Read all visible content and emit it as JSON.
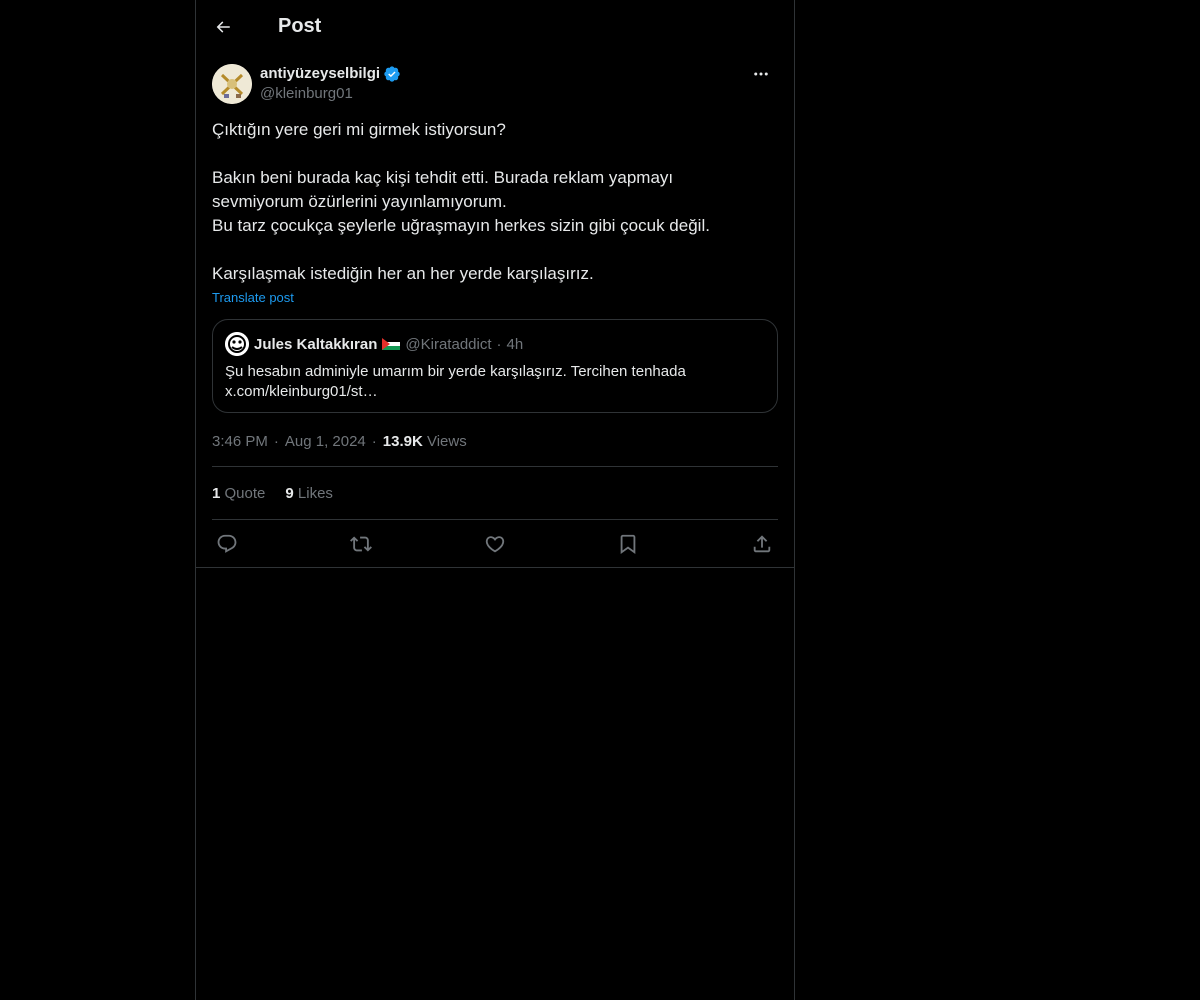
{
  "header": {
    "title": "Post",
    "back_icon": "arrow-left-icon"
  },
  "post": {
    "author": {
      "display_name": "antiyüzeyselbilgi",
      "handle": "@kleinburg01",
      "verified_icon": "verified-badge-icon"
    },
    "text_lines": [
      "Çıktığın yere geri mi girmek istiyorsun?",
      "",
      "Bakın beni burada kaç kişi tehdit etti. Burada reklam yapmayı",
      "sevmiyorum özürlerini yayınlamıyorum.",
      "Bu tarz çocukça şeylerle uğraşmayın herkes sizin gibi çocuk değil.",
      "",
      "Karşılaşmak istediğin her an her yerde karşılaşırız."
    ],
    "translate_label": "Translate post",
    "quote": {
      "display_name": "Jules Kaltakkıran",
      "flag_icon": "palestine-flag-icon",
      "handle": "@Kirataddict",
      "dot": "·",
      "time": "4h",
      "text_line1": "Şu hesabın adminiyle umarım bir yerde karşılaşırız. Tercihen tenhada",
      "text_line2": "x.com/kleinburg01/st…"
    },
    "time": "3:46 PM",
    "sep": "·",
    "date": "Aug 1, 2024",
    "views_count": "13.9K",
    "views_label": "Views",
    "stats": {
      "quotes_count": "1",
      "quotes_label": "Quote",
      "likes_count": "9",
      "likes_label": "Likes"
    },
    "actions": [
      "reply-icon",
      "repost-icon",
      "like-icon",
      "bookmark-icon",
      "share-icon"
    ]
  },
  "colors": {
    "background": "#000000",
    "text": "#e7e9ea",
    "muted": "#71767b",
    "accent": "#1d9bf0",
    "border": "#2f3336"
  }
}
